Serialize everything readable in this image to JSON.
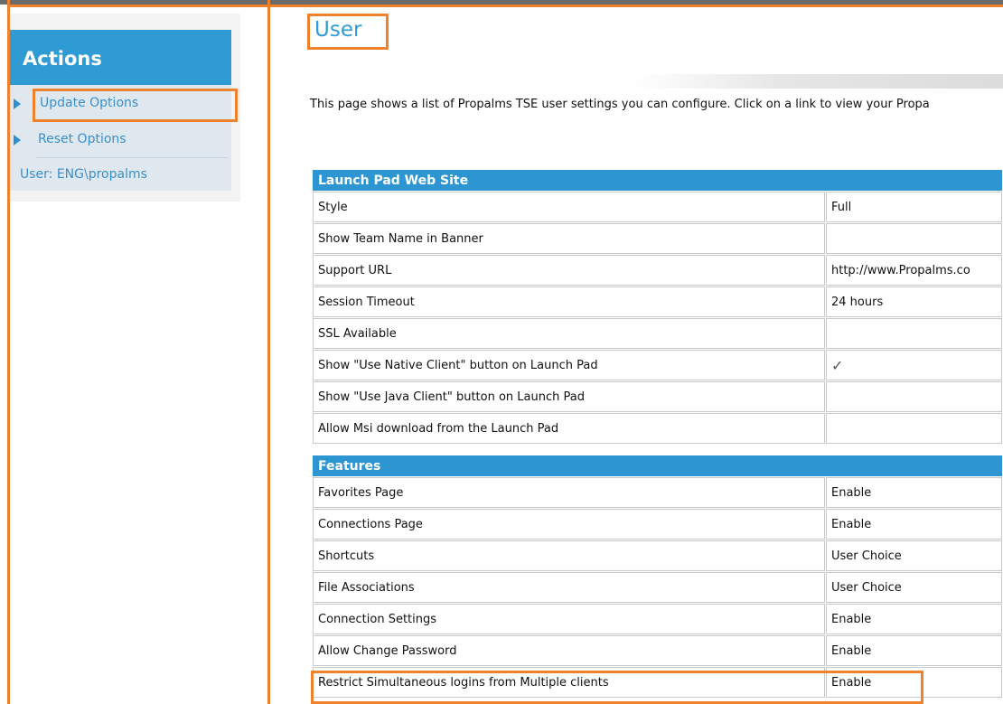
{
  "sidebar": {
    "title": "Actions",
    "items": [
      {
        "label": "Update Options"
      },
      {
        "label": "Reset Options"
      }
    ],
    "user_label": "User: ENG\\propalms"
  },
  "page": {
    "title": "User",
    "intro": "This page shows a list of Propalms TSE user settings you can configure. Click on a link to view your Propa"
  },
  "sections": [
    {
      "header": "Launch Pad Web Site",
      "rows": [
        {
          "label": "Style",
          "value": "Full"
        },
        {
          "label": "Show Team Name in Banner",
          "value": ""
        },
        {
          "label": "Support URL",
          "value": "http://www.Propalms.co"
        },
        {
          "label": "Session Timeout",
          "value": "24 hours"
        },
        {
          "label": "SSL Available",
          "value": ""
        },
        {
          "label": "Show \"Use Native Client\" button on Launch Pad",
          "value": "✓"
        },
        {
          "label": "Show \"Use Java Client\" button on Launch Pad",
          "value": ""
        },
        {
          "label": "Allow Msi download from the Launch Pad",
          "value": ""
        }
      ]
    },
    {
      "header": "Features",
      "rows": [
        {
          "label": "Favorites Page",
          "value": "Enable"
        },
        {
          "label": "Connections Page",
          "value": "Enable"
        },
        {
          "label": "Shortcuts",
          "value": "User Choice"
        },
        {
          "label": "File Associations",
          "value": "User Choice"
        },
        {
          "label": "Connection Settings",
          "value": "Enable"
        },
        {
          "label": "Allow Change Password",
          "value": "Enable"
        },
        {
          "label": "Restrict Simultaneous logins from Multiple clients",
          "value": "Enable"
        }
      ]
    }
  ],
  "icons": {
    "bullet": "triangle-right-icon",
    "check": "checkmark-icon"
  },
  "colors": {
    "accent": "#2e9bd4",
    "highlight": "#f0822d",
    "header": "#2c95d2"
  }
}
